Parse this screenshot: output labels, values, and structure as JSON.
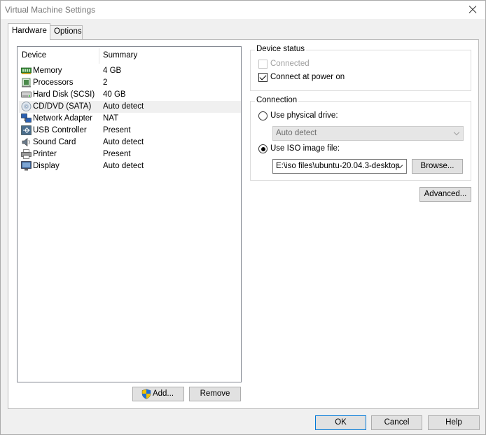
{
  "window": {
    "title": "Virtual Machine Settings"
  },
  "tabs": [
    {
      "label": "Hardware",
      "active": true
    },
    {
      "label": "Options",
      "active": false
    }
  ],
  "device_list": {
    "headers": {
      "device": "Device",
      "summary": "Summary"
    },
    "items": [
      {
        "icon": "memory-icon",
        "name": "Memory",
        "summary": "4 GB",
        "selected": false
      },
      {
        "icon": "processor-icon",
        "name": "Processors",
        "summary": "2",
        "selected": false
      },
      {
        "icon": "hard-disk-icon",
        "name": "Hard Disk (SCSI)",
        "summary": "40 GB",
        "selected": false
      },
      {
        "icon": "cd-dvd-icon",
        "name": "CD/DVD (SATA)",
        "summary": "Auto detect",
        "selected": true
      },
      {
        "icon": "network-adapter-icon",
        "name": "Network Adapter",
        "summary": "NAT",
        "selected": false
      },
      {
        "icon": "usb-icon",
        "name": "USB Controller",
        "summary": "Present",
        "selected": false
      },
      {
        "icon": "sound-card-icon",
        "name": "Sound Card",
        "summary": "Auto detect",
        "selected": false
      },
      {
        "icon": "printer-icon",
        "name": "Printer",
        "summary": "Present",
        "selected": false
      },
      {
        "icon": "display-icon",
        "name": "Display",
        "summary": "Auto detect",
        "selected": false
      }
    ],
    "add_button": "Add...",
    "remove_button": "Remove"
  },
  "device_status": {
    "label": "Device status",
    "connected": {
      "label": "Connected",
      "checked": false,
      "disabled": true
    },
    "connect_at_power_on": {
      "label": "Connect at power on",
      "checked": true
    }
  },
  "connection": {
    "label": "Connection",
    "physical_drive": {
      "label": "Use physical drive:",
      "selected": false,
      "value": "Auto detect"
    },
    "iso_image": {
      "label": "Use ISO image file:",
      "selected": true,
      "value": "E:\\iso files\\ubuntu-20.04.3-desktop"
    },
    "browse_button": "Browse...",
    "advanced_button": "Advanced..."
  },
  "footer": {
    "ok": "OK",
    "cancel": "Cancel",
    "help": "Help"
  },
  "colors": {
    "selection": "#f0f0f0",
    "default_button_border": "#0078d7",
    "shield_blue": "#1f6fd6",
    "shield_yellow": "#f2c200"
  }
}
